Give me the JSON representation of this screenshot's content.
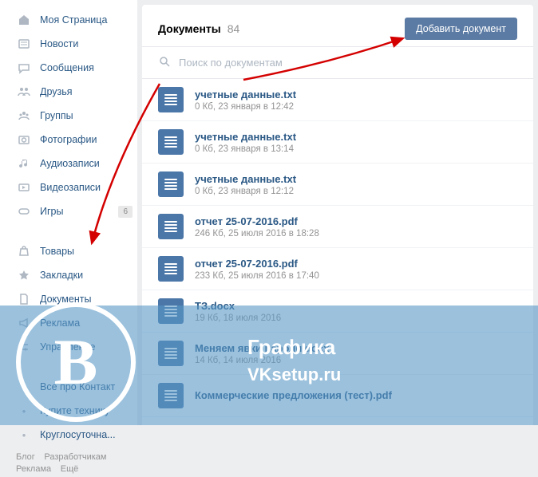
{
  "sidebar": {
    "items": [
      {
        "label": "Моя Страница",
        "icon": "home"
      },
      {
        "label": "Новости",
        "icon": "news"
      },
      {
        "label": "Сообщения",
        "icon": "messages"
      },
      {
        "label": "Друзья",
        "icon": "friends"
      },
      {
        "label": "Группы",
        "icon": "groups"
      },
      {
        "label": "Фотографии",
        "icon": "photos"
      },
      {
        "label": "Аудиозаписи",
        "icon": "audio"
      },
      {
        "label": "Видеозаписи",
        "icon": "video"
      },
      {
        "label": "Игры",
        "icon": "games",
        "badge": "6"
      }
    ],
    "items2": [
      {
        "label": "Товары",
        "icon": "market"
      },
      {
        "label": "Закладки",
        "icon": "bookmarks"
      },
      {
        "label": "Документы",
        "icon": "docs"
      },
      {
        "label": "Реклама",
        "icon": "ads"
      },
      {
        "label": "Управление",
        "icon": "manage"
      }
    ],
    "items3": [
      {
        "label": "Все про Контакт"
      },
      {
        "label": "Купите технику"
      },
      {
        "label": "Круглосуточна..."
      }
    ],
    "footer": [
      "Блог",
      "Разработчикам",
      "Реклама",
      "Ещё"
    ]
  },
  "header": {
    "title": "Документы",
    "count": "84",
    "add_button": "Добавить документ"
  },
  "search": {
    "placeholder": "Поиск по документам"
  },
  "documents": [
    {
      "title": "учетные данные.txt",
      "sub": "0 Кб, 23 января в 12:42"
    },
    {
      "title": "учетные данные.txt",
      "sub": "0 Кб, 23 января в 13:14"
    },
    {
      "title": "учетные данные.txt",
      "sub": "0 Кб, 23 января в 12:12"
    },
    {
      "title": "отчет 25-07-2016.pdf",
      "sub": "246 Кб, 25 июля 2016 в 18:28"
    },
    {
      "title": "отчет 25-07-2016.pdf",
      "sub": "233 Кб, 25 июля 2016 в 17:40"
    },
    {
      "title": "ТЗ.docx",
      "sub": "19 Кб, 18 июля 2016"
    },
    {
      "title": "Меняем явки пароли.docx",
      "sub": "14 Кб, 14 июля 2016"
    },
    {
      "title": "Коммерческие предложения (тест).pdf",
      "sub": ""
    }
  ],
  "overlay": {
    "logo": "В",
    "text1": "Графика",
    "text2": "VKsetup.ru"
  }
}
